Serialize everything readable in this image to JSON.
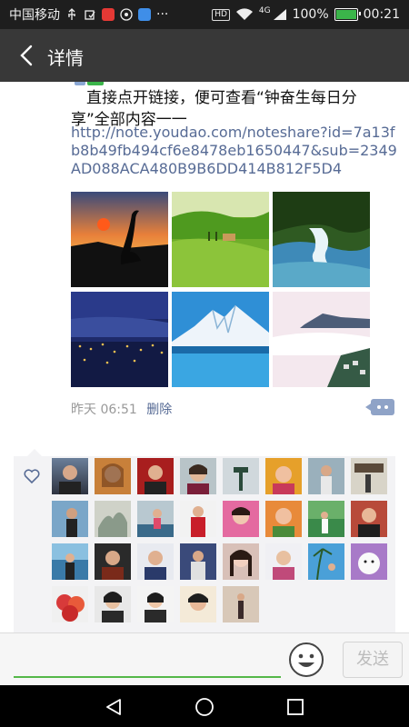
{
  "status_bar": {
    "carrier": "中国移动",
    "more": "···",
    "hd": "HD",
    "network": "4G",
    "battery": "100%",
    "time": "00:21"
  },
  "nav": {
    "title": "详情",
    "back_icon": "back-arrow-icon"
  },
  "post": {
    "text": "直接点开链接，便可查看“钟奋生每日分享”全部内容一一",
    "link": "http://note.youdao.com/noteshare?id=7a13fb8b49fb494cf6e8478eb1650447&sub=2349AD088ACA480B9B6DD414B812F5D4",
    "photos": [
      "sunset-crane",
      "green-hills",
      "waterfall",
      "city-night-bay",
      "snow-mountain",
      "sea-of-clouds"
    ]
  },
  "meta": {
    "time": "昨天 06:51",
    "delete": "删除"
  },
  "likes": {
    "icon": "heart-icon",
    "count": 28
  },
  "input": {
    "send": "发送",
    "emoji_icon": "emoji-icon"
  },
  "system_nav": [
    "back-triangle-icon",
    "home-circle-icon",
    "recents-square-icon"
  ],
  "colors": {
    "link": "#576b95",
    "accent": "#3bb54a",
    "navbar": "#383838"
  }
}
